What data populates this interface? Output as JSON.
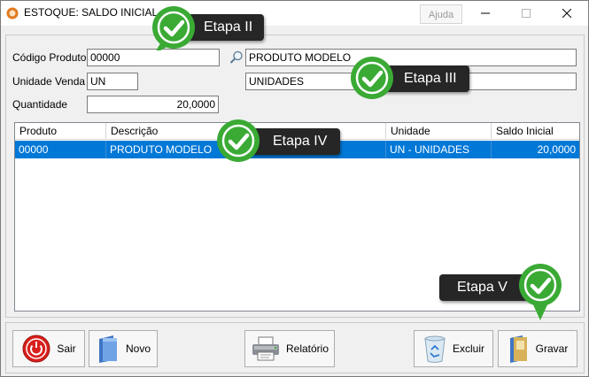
{
  "window": {
    "title": "ESTOQUE: SALDO INICIAL",
    "help_label": "Ajuda"
  },
  "form": {
    "codigo_label": "Código Produto",
    "codigo_value": "00000",
    "descricao_value": "PRODUTO MODELO",
    "unidade_label": "Unidade Venda",
    "unidade_value": "UN",
    "unidade_desc_value": "UNIDADES",
    "quantidade_label": "Quantidade",
    "quantidade_value": "20,0000"
  },
  "grid": {
    "columns": [
      "Produto",
      "Descrição",
      "Unidade",
      "Saldo Inicial"
    ],
    "rows": [
      [
        "00000",
        "PRODUTO MODELO",
        "UN - UNIDADES",
        "20,0000"
      ]
    ]
  },
  "toolbar": {
    "sair": "Sair",
    "novo": "Novo",
    "relatorio": "Relatório",
    "excluir": "Excluir",
    "gravar": "Gravar"
  },
  "callouts": {
    "etapa2": "Etapa II",
    "etapa3": "Etapa III",
    "etapa4": "Etapa IV",
    "etapa5": "Etapa V"
  },
  "colors": {
    "selection": "#0078d7",
    "callout_bg": "#262626",
    "check_green": "#3aaa35"
  }
}
